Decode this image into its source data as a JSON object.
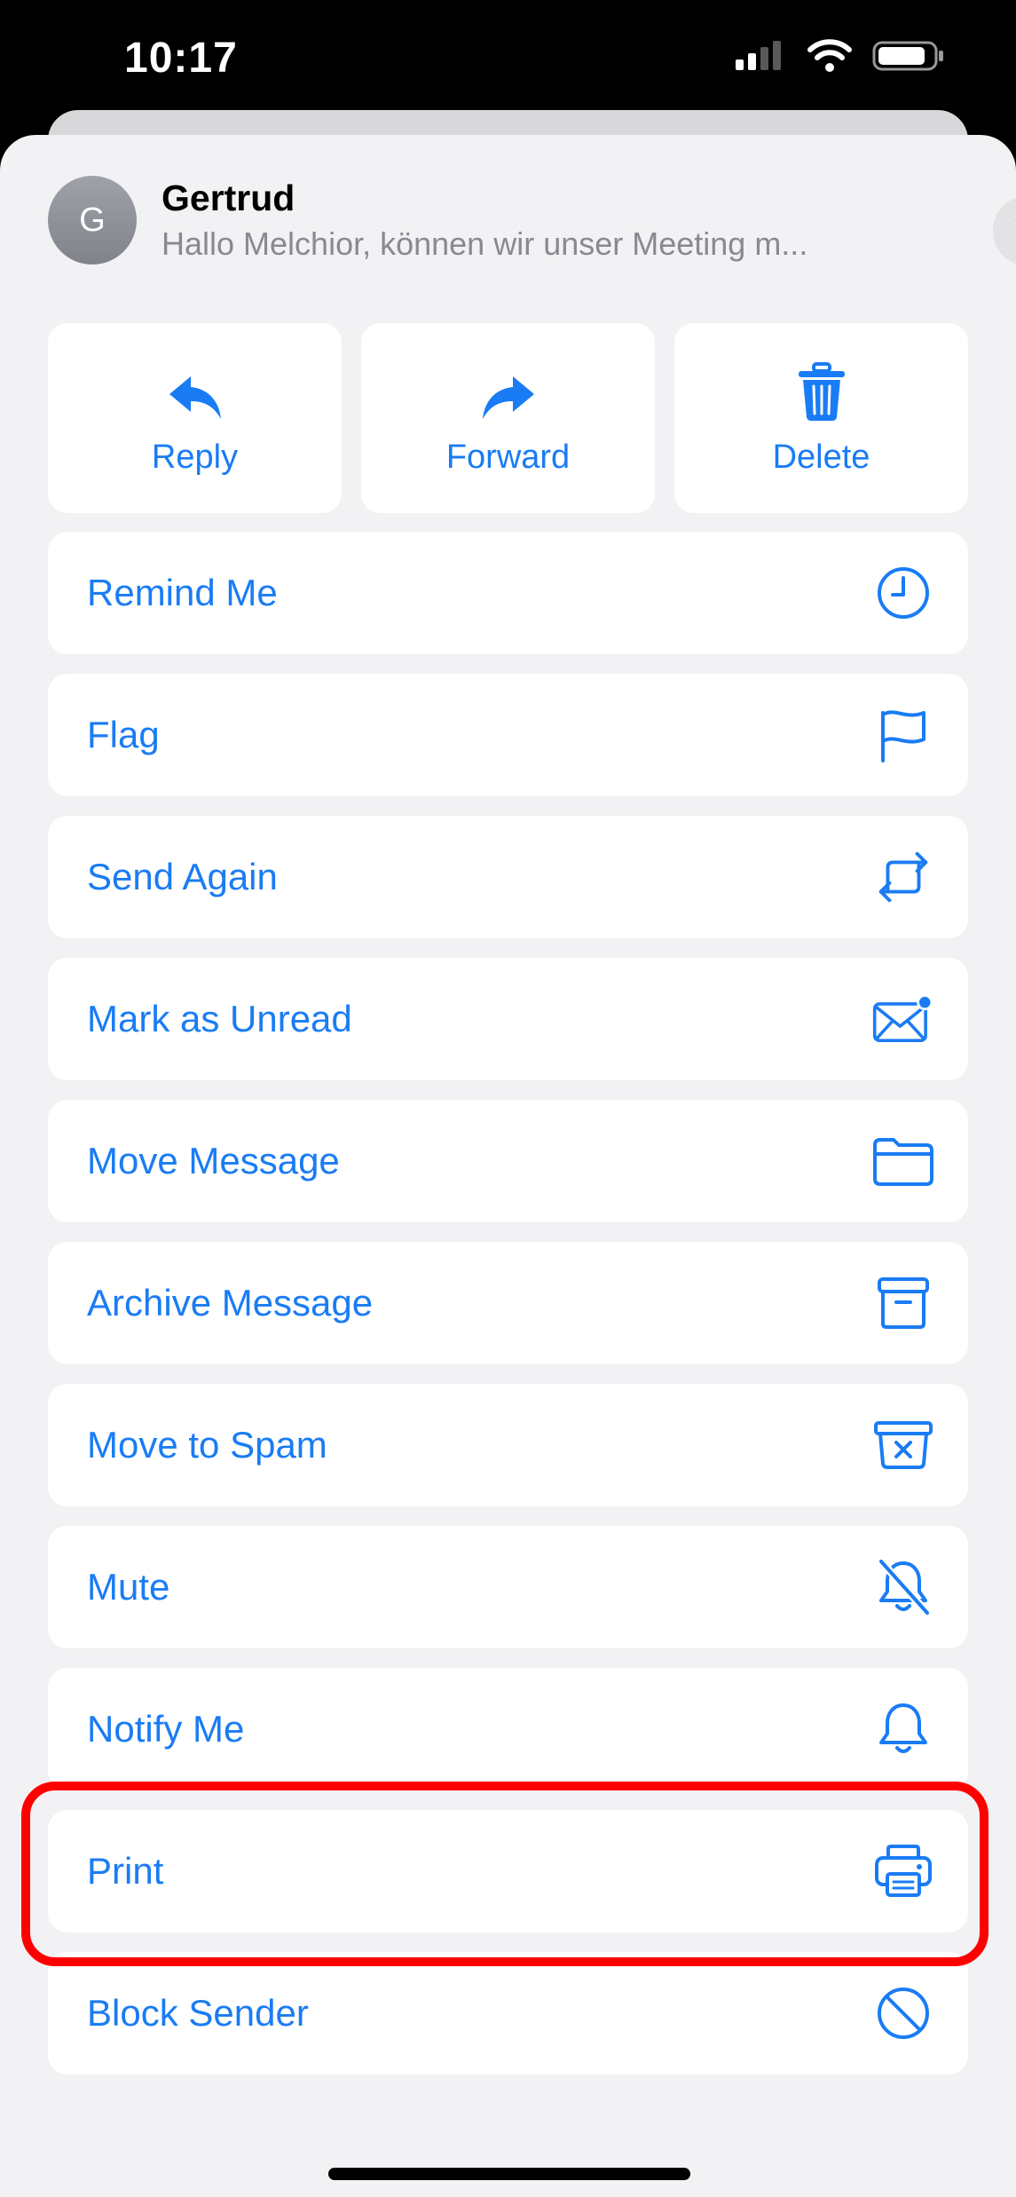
{
  "status_bar": {
    "time": "10:17"
  },
  "header": {
    "avatar_initial": "G",
    "sender": "Gertrud",
    "preview": "Hallo Melchior, können wir unser Meeting m..."
  },
  "quick_actions": [
    {
      "label": "Reply",
      "icon": "reply-icon"
    },
    {
      "label": "Forward",
      "icon": "forward-icon"
    },
    {
      "label": "Delete",
      "icon": "trash-icon"
    }
  ],
  "menu": [
    {
      "label": "Remind Me",
      "icon": "clock-icon"
    },
    {
      "label": "Flag",
      "icon": "flag-icon"
    },
    {
      "label": "Send Again",
      "icon": "resend-icon"
    },
    {
      "label": "Mark as Unread",
      "icon": "unread-envelope-icon"
    },
    {
      "label": "Move Message",
      "icon": "folder-icon"
    },
    {
      "label": "Archive Message",
      "icon": "archive-box-icon"
    },
    {
      "label": "Move to Spam",
      "icon": "spam-box-icon"
    },
    {
      "label": "Mute",
      "icon": "bell-slash-icon"
    },
    {
      "label": "Notify Me",
      "icon": "bell-icon"
    },
    {
      "label": "Print",
      "icon": "printer-icon"
    },
    {
      "label": "Block Sender",
      "icon": "block-icon"
    }
  ],
  "colors": {
    "accent": "#1a7cf4",
    "highlight": "#ff0000",
    "sheet_bg": "#f2f2f4"
  }
}
